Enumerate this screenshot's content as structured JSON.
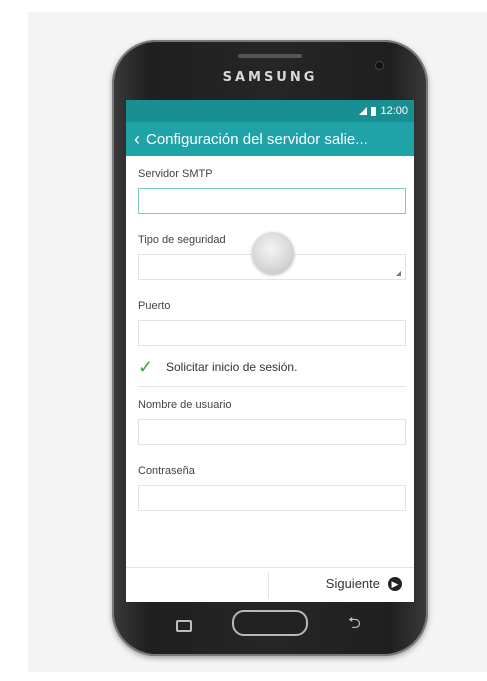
{
  "device": {
    "brand": "SAMSUNG",
    "status_time": "12:00"
  },
  "appbar": {
    "back_icon": "chevron-left-icon",
    "title": "Configuración del servidor salie..."
  },
  "form": {
    "smtp_server": {
      "label": "Servidor SMTP",
      "value": ""
    },
    "security_type": {
      "label": "Tipo de seguridad",
      "value": ""
    },
    "port": {
      "label": "Puerto",
      "value": ""
    },
    "login_required": {
      "label": "Solicitar inicio de sesión.",
      "checked": true
    },
    "username": {
      "label": "Nombre de usuario",
      "value": ""
    },
    "password": {
      "label": "Contraseña",
      "value": ""
    }
  },
  "footer": {
    "next_label": "Siguiente",
    "next_icon": "arrow-right-circle-icon"
  },
  "colors": {
    "statusbar": "#1a8f93",
    "appbar": "#1fa3a7",
    "check": "#39a845"
  }
}
